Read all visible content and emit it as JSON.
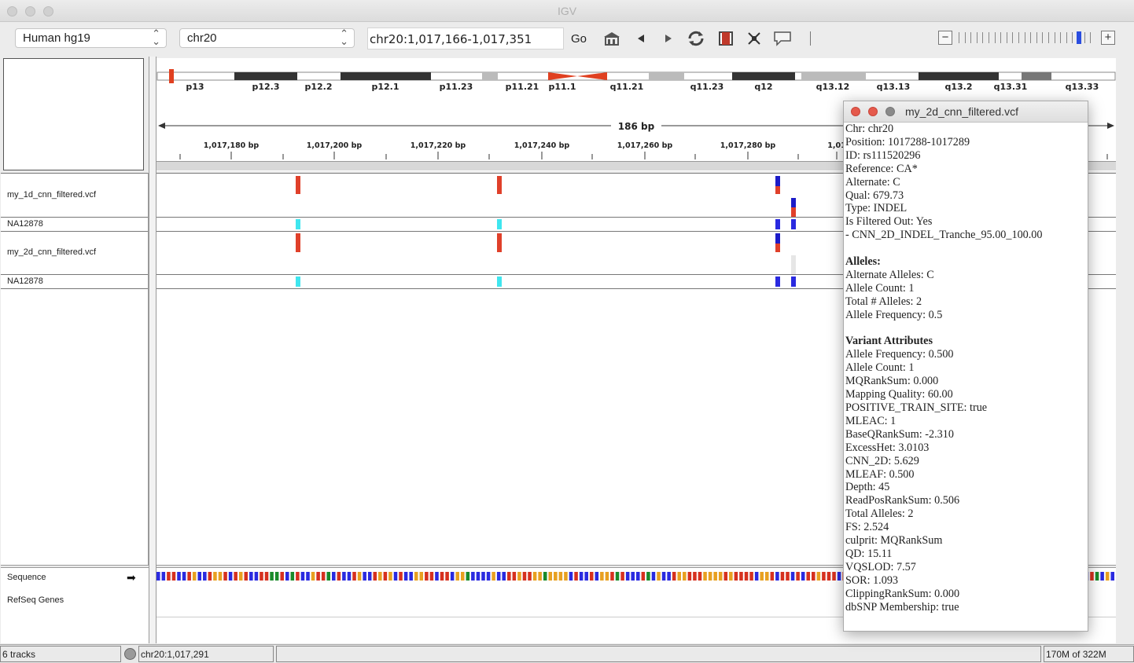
{
  "window": {
    "title": "IGV"
  },
  "toolbar": {
    "genome": "Human hg19",
    "chromosome": "chr20",
    "locus": "chr20:1,017,166-1,017,351",
    "go_label": "Go"
  },
  "ideogram": {
    "bands": [
      "p13",
      "p12.3",
      "p12.2",
      "p12.1",
      "p11.23",
      "p11.21",
      "p11.1",
      "q11.21",
      "q11.23",
      "q12",
      "q13.12",
      "q13.13",
      "q13.2",
      "q13.31",
      "q13.33"
    ]
  },
  "ruler": {
    "span_label": "186 bp",
    "ticks": [
      "1,017,180 bp",
      "1,017,200 bp",
      "1,017,220 bp",
      "1,017,240 bp",
      "1,017,260 bp",
      "1,017,280 bp",
      "1,01"
    ]
  },
  "tracks": {
    "vcf1": "my_1d_cnn_filtered.vcf",
    "sample1": "NA12878",
    "vcf2": "my_2d_cnn_filtered.vcf",
    "sample2": "NA12878",
    "sequence": "Sequence",
    "genes": "RefSeq Genes"
  },
  "colors": {
    "variant_filtered": "#e0402a",
    "genotype_het": "#3fe6ef",
    "genotype_homvar": "#2a2ae0",
    "indel_dark": "#1c1cc8"
  },
  "status": {
    "tracks": "6 tracks",
    "position": "chr20:1,017,291",
    "memory": "170M of 322M"
  },
  "popup": {
    "title": "my_2d_cnn_filtered.vcf",
    "lines": [
      "Chr: chr20",
      "Position: 1017288-1017289",
      "ID: rs111520296",
      "Reference: CA*",
      "Alternate: C",
      "Qual: 679.73",
      "Type: INDEL",
      "Is Filtered Out: Yes",
      "- CNN_2D_INDEL_Tranche_95.00_100.00",
      "",
      "Alleles:",
      "Alternate Alleles: C",
      "Allele Count: 1",
      "Total # Alleles: 2",
      "Allele Frequency: 0.5",
      "",
      "Variant Attributes",
      "Allele Frequency: 0.500",
      "Allele Count: 1",
      "MQRankSum: 0.000",
      "Mapping Quality: 60.00",
      "POSITIVE_TRAIN_SITE: true",
      "MLEAC: 1",
      "BaseQRankSum: -2.310",
      "ExcessHet: 3.0103",
      "CNN_2D: 5.629",
      "MLEAF: 0.500",
      "Depth: 45",
      "ReadPosRankSum: 0.506",
      "Total Alleles: 2",
      "FS: 2.524",
      "culprit: MQRankSum",
      "QD: 15.11",
      "VQSLOD: 7.57",
      "SOR: 1.093",
      "ClippingRankSum: 0.000",
      "dbSNP Membership: true"
    ]
  }
}
